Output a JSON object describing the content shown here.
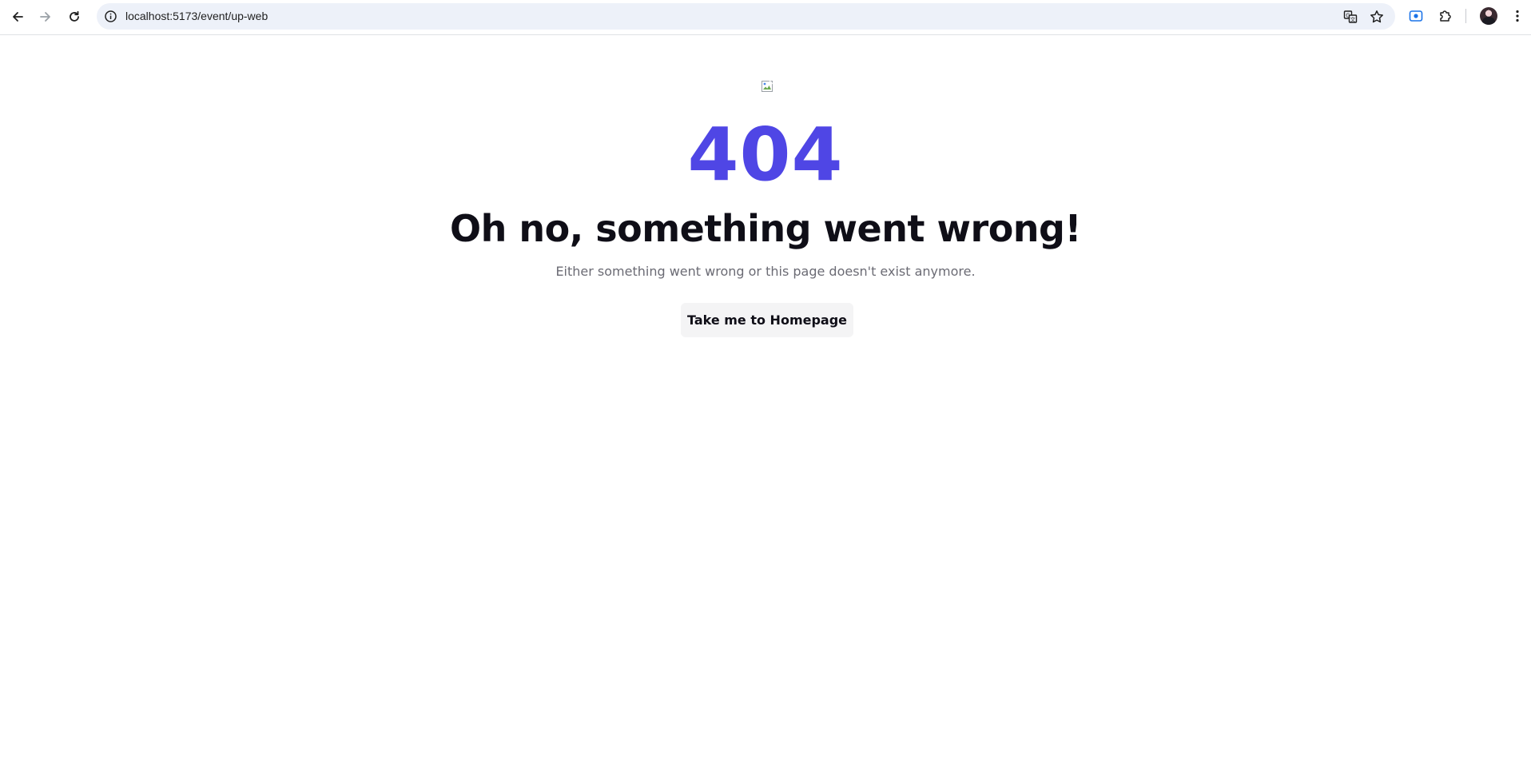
{
  "browser": {
    "url": "localhost:5173/event/up-web",
    "icons": {
      "back": "arrow-left-icon",
      "forward": "arrow-right-icon",
      "reload": "reload-icon",
      "site_info": "info-icon",
      "translate": "translate-icon",
      "bookmark": "star-icon",
      "extension_active": "screen-record-icon",
      "extensions": "puzzle-icon",
      "profile": "avatar",
      "menu": "kebab-menu-icon"
    },
    "colors": {
      "omnibox_bg": "#edf1f9",
      "accent": "#1a73e8"
    }
  },
  "error_page": {
    "code": "404",
    "headline": "Oh no, something went wrong!",
    "message": "Either something went wrong or this page doesn't exist anymore.",
    "button_label": "Take me to Homepage",
    "image_icon": "broken-image-icon",
    "colors": {
      "code": "#4f46e5",
      "headline": "#0f0e17",
      "message": "#6b6b74",
      "button_bg": "#f4f4f5"
    }
  }
}
